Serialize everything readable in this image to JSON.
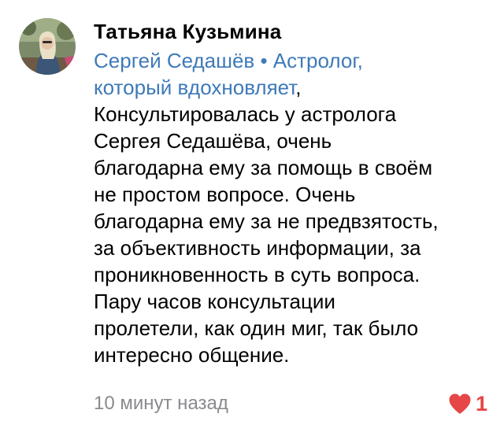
{
  "comment": {
    "author": "Татьяна Кузьмина",
    "mention_line1": "Сергей Седашёв • Астролог,",
    "mention_line2": "который вдохновляет",
    "mention_comma": ",",
    "text_lines": [
      "Консультировалась у  астролога",
      "Сергея Седашёва, очень",
      "благодарна ему за помощь в своём",
      "не простом вопросе. Очень",
      "благодарна ему за не предвзятость,",
      "за объективность информации, за",
      "проникновенность в суть вопроса.",
      "Пару часов консультации",
      "пролетели, как один миг, так было",
      "интересно общение."
    ],
    "timestamp": "10 минут назад",
    "like_count": "1",
    "like_icon": "heart-icon",
    "colors": {
      "mention": "#3e7ab8",
      "timestamp": "#8a8a8e",
      "like": "#e64646"
    }
  }
}
